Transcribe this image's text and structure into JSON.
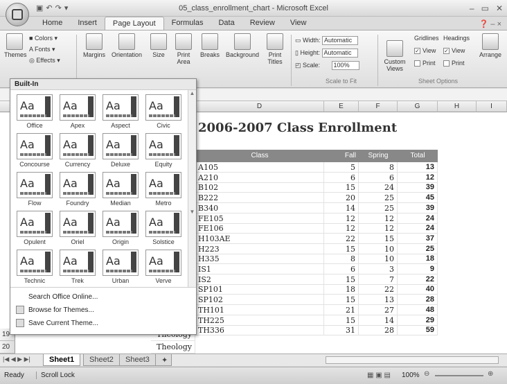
{
  "window": {
    "title": "05_class_enrollment_chart - Microsoft Excel"
  },
  "tabs": [
    "Home",
    "Insert",
    "Page Layout",
    "Formulas",
    "Data",
    "Review",
    "View"
  ],
  "active_tab": "Page Layout",
  "ribbon": {
    "themes": "Themes",
    "colors": "Colors",
    "fonts": "Fonts",
    "effects": "Effects",
    "margins": "Margins",
    "orientation": "Orientation",
    "size": "Size",
    "print_area": "Print Area",
    "breaks": "Breaks",
    "background": "Background",
    "print_titles": "Print Titles",
    "width_label": "Width:",
    "width_value": "Automatic",
    "height_label": "Height:",
    "height_value": "Automatic",
    "scale_label": "Scale:",
    "scale_value": "100%",
    "scale_group": "Scale to Fit",
    "custom_views": "Custom Views",
    "gridlines": "Gridlines",
    "headings": "Headings",
    "view": "View",
    "print": "Print",
    "sheet_options_group": "Sheet Options",
    "arrange": "Arrange"
  },
  "gallery": {
    "header": "Built-In",
    "themes": [
      "Office",
      "Apex",
      "Aspect",
      "Civic",
      "Concourse",
      "Currency",
      "Deluxe",
      "Equity",
      "Flow",
      "Foundry",
      "Median",
      "Metro",
      "Opulent",
      "Oriel",
      "Origin",
      "Solstice",
      "Technic",
      "Trek",
      "Urban",
      "Verve"
    ],
    "footer": [
      "Search Office Online...",
      "Browse for Themes...",
      "Save Current Theme..."
    ]
  },
  "sheet": {
    "columns": [
      "D",
      "E",
      "F",
      "G",
      "H",
      "I"
    ],
    "title": "2006-2007 Class Enrollment",
    "headers": {
      "class": "Class",
      "fall": "Fall",
      "spring": "Spring",
      "total": "Total"
    },
    "rows": [
      {
        "class": "A105",
        "fall": "5",
        "spring": "8",
        "total": "13"
      },
      {
        "class": "A210",
        "fall": "6",
        "spring": "6",
        "total": "12"
      },
      {
        "class": "B102",
        "fall": "15",
        "spring": "24",
        "total": "39"
      },
      {
        "class": "B222",
        "fall": "20",
        "spring": "25",
        "total": "45"
      },
      {
        "class": "B340",
        "fall": "14",
        "spring": "25",
        "total": "39"
      },
      {
        "class": "FE105",
        "fall": "12",
        "spring": "12",
        "total": "24"
      },
      {
        "class": "FE106",
        "fall": "12",
        "spring": "12",
        "total": "24"
      },
      {
        "class": "H103AE",
        "fall": "22",
        "spring": "15",
        "total": "37"
      },
      {
        "class": "H223",
        "fall": "15",
        "spring": "10",
        "total": "25"
      },
      {
        "class": "H335",
        "fall": "8",
        "spring": "10",
        "total": "18"
      },
      {
        "class": "IS1",
        "fall": "6",
        "spring": "3",
        "total": "9"
      },
      {
        "class": "IS2",
        "fall": "15",
        "spring": "7",
        "total": "22"
      },
      {
        "class": "SP101",
        "fall": "18",
        "spring": "22",
        "total": "40"
      },
      {
        "class": "SP102",
        "fall": "15",
        "spring": "13",
        "total": "28"
      },
      {
        "class": "TH101",
        "fall": "21",
        "spring": "27",
        "total": "48"
      },
      {
        "class": "TH225",
        "fall": "15",
        "spring": "14",
        "total": "29"
      },
      {
        "class": "TH336",
        "fall": "31",
        "spring": "28",
        "total": "59"
      }
    ],
    "row19": {
      "num": "19",
      "dept": "Theology"
    },
    "row20": {
      "num": "20",
      "dept": "Theology"
    }
  },
  "sheet_tabs": [
    "Sheet1",
    "Sheet2",
    "Sheet3"
  ],
  "status": {
    "ready": "Ready",
    "scroll_lock": "Scroll Lock",
    "zoom": "100%"
  }
}
